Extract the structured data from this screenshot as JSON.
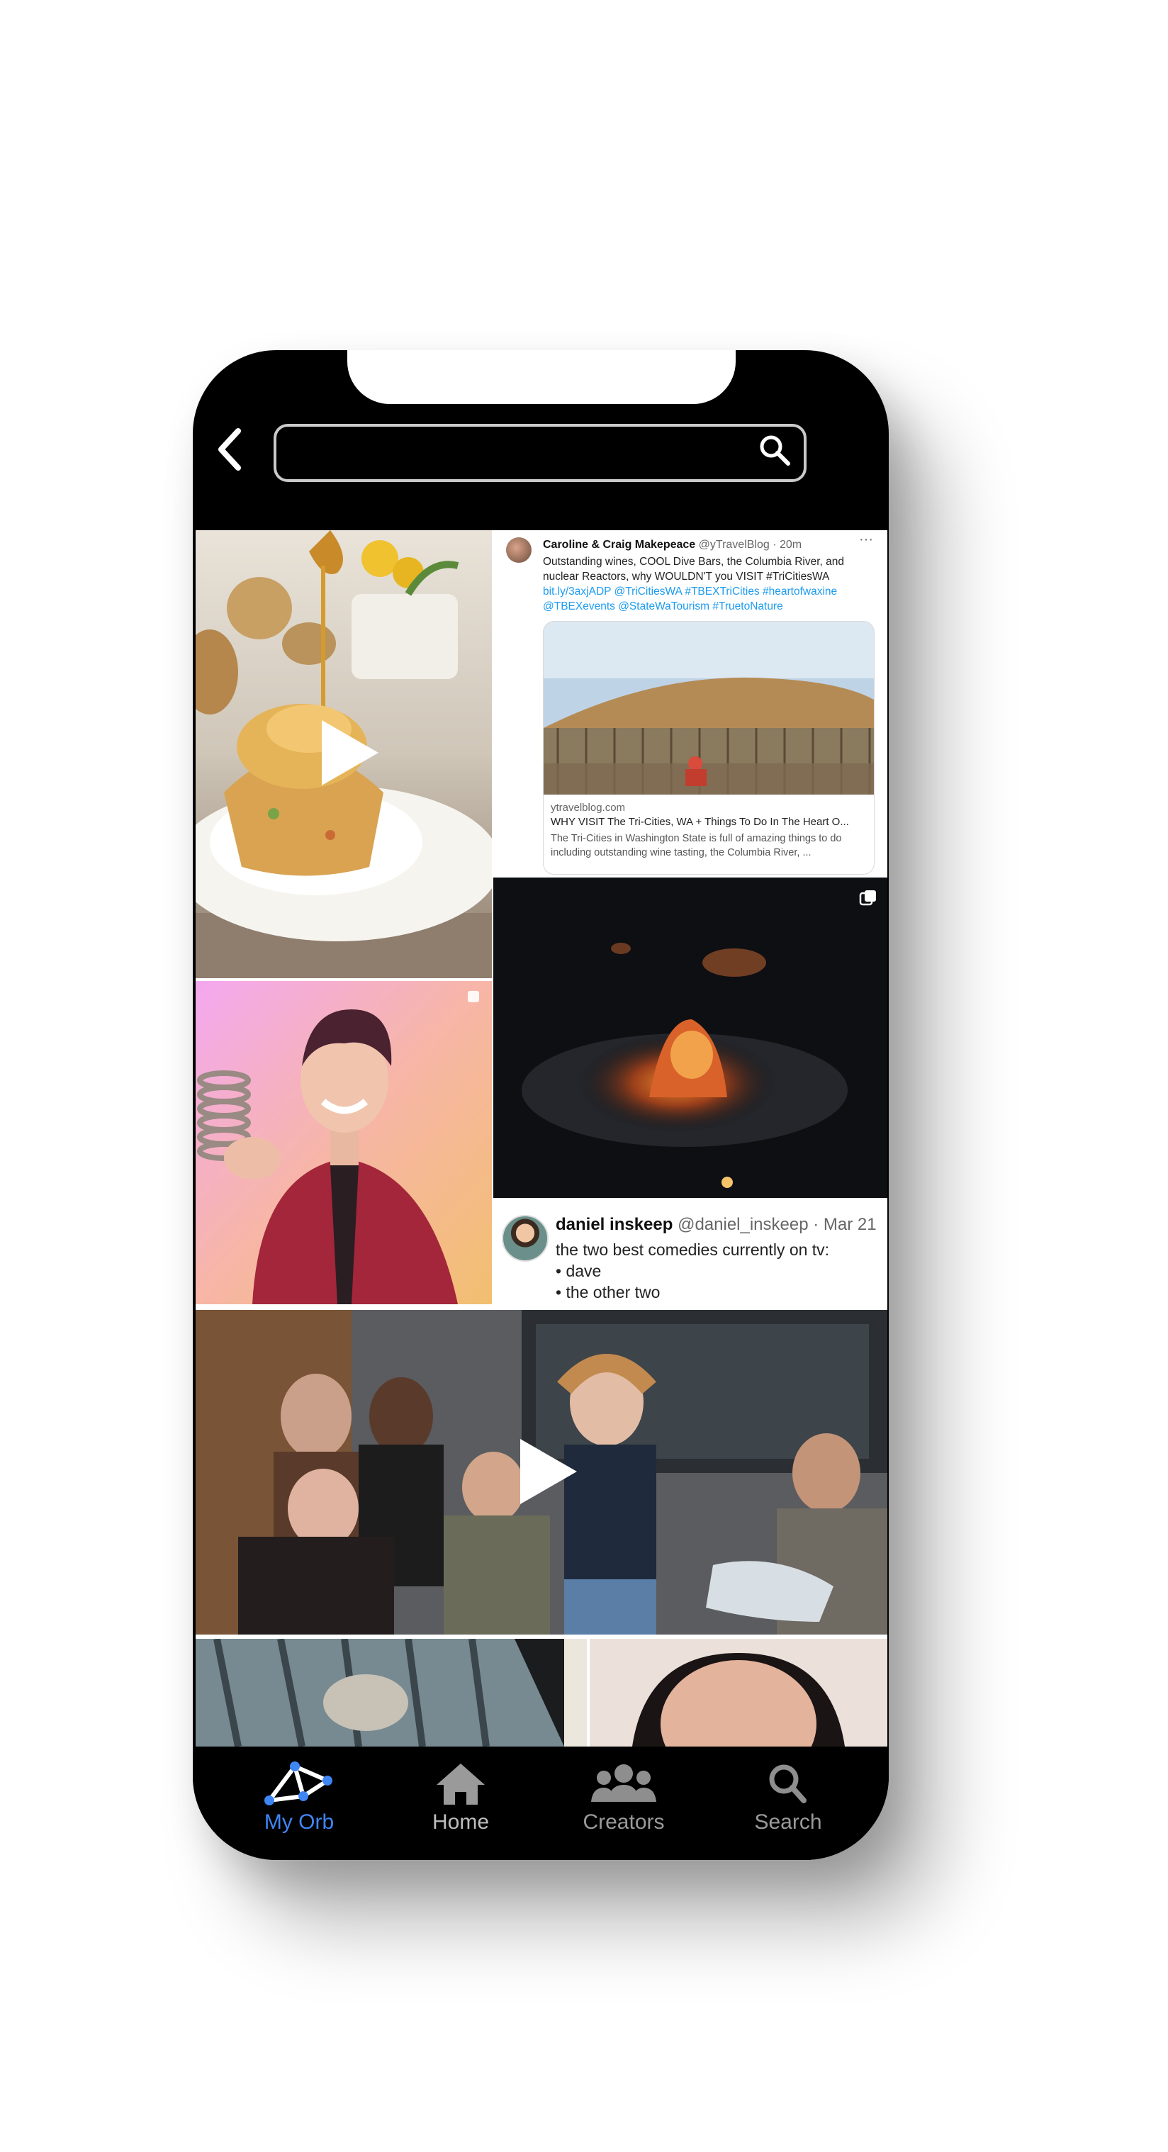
{
  "search": {
    "value": "",
    "placeholder": ""
  },
  "tweet_card": {
    "author": "Caroline & Craig Makepeace",
    "handle_time": "@yTravelBlog · 20m",
    "more": "···",
    "text": "Outstanding wines, COOL Dive Bars, the Columbia River, and nuclear Reactors, why WOULDN'T you VISIT #TriCitiesWA",
    "links": "bit.ly/3axjADP @TriCitiesWA #TBEXTriCities #heartofwaxine @TBEXevents @StateWaTourism #TruetoNature",
    "link_domain": "ytravelblog.com",
    "link_title": "WHY VISIT The Tri-Cities, WA + Things To Do In The Heart O...",
    "link_desc": "The Tri-Cities in Washington State is full of amazing things to do including outstanding wine tasting, the Columbia River, ..."
  },
  "tweet_text": {
    "author": "daniel inskeep",
    "handle_time": "@daniel_inskeep · Mar 21",
    "lines": [
      "the two best comedies currently on tv:",
      "• dave",
      "• the other two"
    ]
  },
  "nav": {
    "items": [
      {
        "label": "My Orb",
        "icon": "orb-icon",
        "active": true
      },
      {
        "label": "Home",
        "icon": "home-icon",
        "active": false
      },
      {
        "label": "Creators",
        "icon": "people-icon",
        "active": false
      },
      {
        "label": "Search",
        "icon": "search-icon",
        "active": false
      }
    ]
  },
  "colors": {
    "accent": "#3f86f5",
    "background": "#000000",
    "link": "#1d9bf0"
  }
}
